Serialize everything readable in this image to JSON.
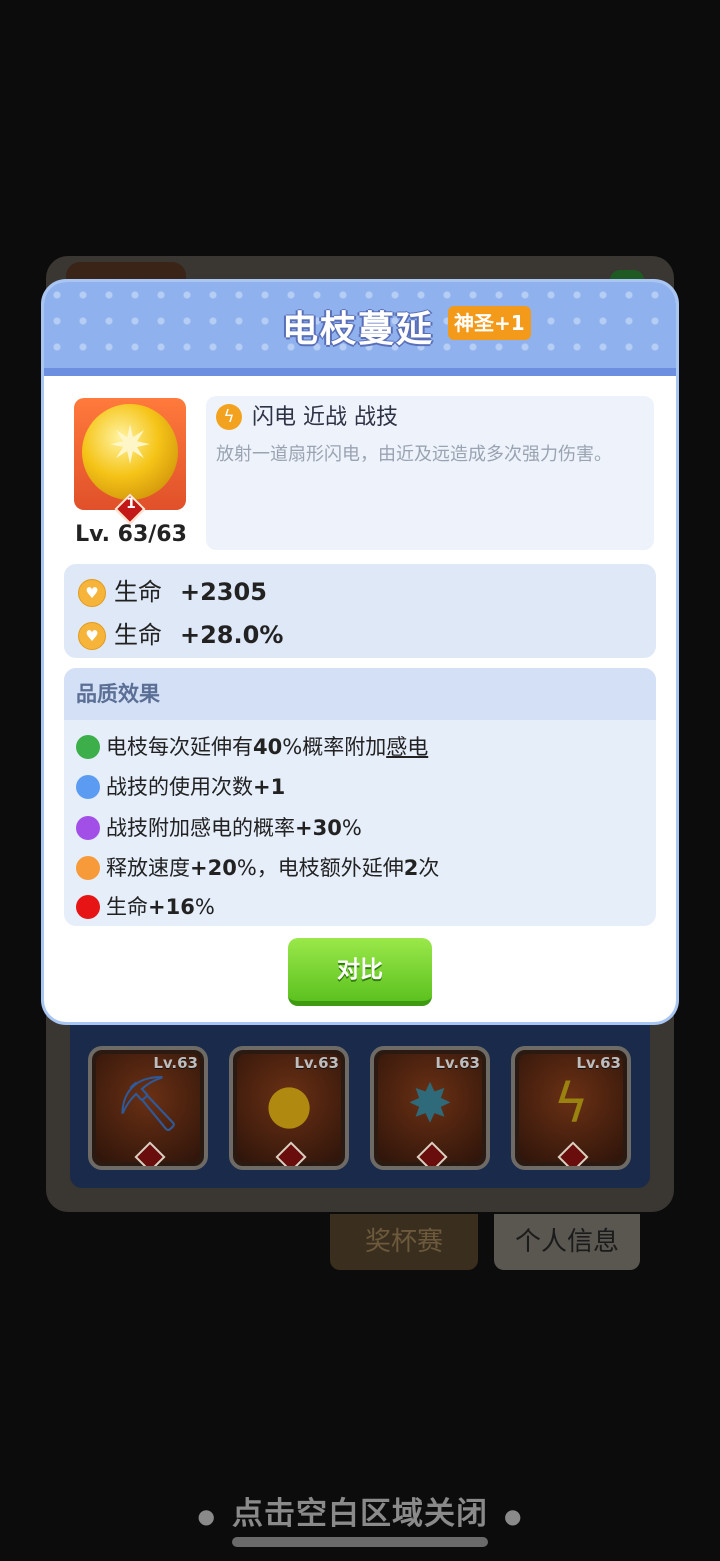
{
  "popup": {
    "title": "电枝蔓延",
    "quality_badge": "神圣+1",
    "item": {
      "level": "Lv. 63/63",
      "gem_number": "1"
    },
    "skill": {
      "tags": "闪电 近战 战技",
      "description": "放射一道扇形闪电，由近及远造成多次强力伤害。"
    },
    "stats": [
      {
        "label": "生命",
        "value": "+2305"
      },
      {
        "label": "生命",
        "value": "+28.0%"
      }
    ],
    "effects": {
      "heading": "品质效果",
      "items": [
        {
          "color": "#3cae4a",
          "pre": "电枝每次延伸有",
          "bold": "40",
          "post": "%概率附加",
          "underline": "感电"
        },
        {
          "color": "#5b9cf2",
          "pre": "战技的使用次数",
          "bold": "+1",
          "post": "",
          "underline": ""
        },
        {
          "color": "#a14fe6",
          "pre": "战技附加感电的概率",
          "bold": "+30",
          "post": "%",
          "underline": ""
        },
        {
          "color": "#f69a3a",
          "pre": "释放速度",
          "bold": "+20",
          "post": "%，电枝额外延伸",
          "bold2": "2",
          "post2": "次"
        },
        {
          "color": "#e61414",
          "pre": "生命",
          "bold": "+16",
          "post": "%",
          "underline": ""
        }
      ]
    },
    "compare_button": "对比"
  },
  "background": {
    "equip_slots": [
      {
        "level": "Lv.63",
        "icon": "pickaxe-icon"
      },
      {
        "level": "Lv.63",
        "icon": "lightning-coin-icon"
      },
      {
        "level": "Lv.63",
        "icon": "star-shield-icon"
      },
      {
        "level": "Lv.63",
        "icon": "lightning-amulet-icon"
      }
    ],
    "tabs": [
      "奖杯赛",
      "个人信息"
    ]
  },
  "close_hint": "点击空白区域关闭"
}
